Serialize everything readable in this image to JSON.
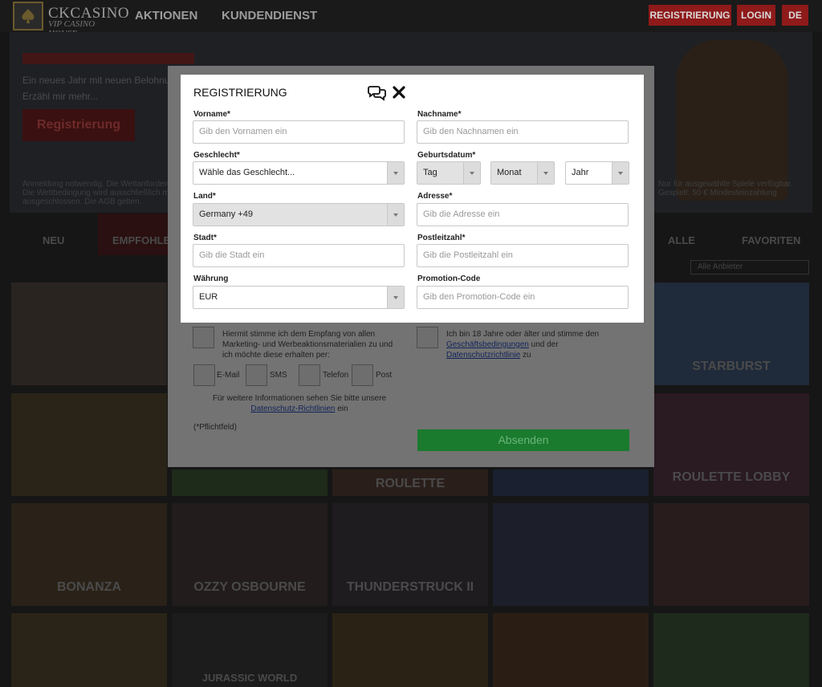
{
  "header": {
    "logo_name": "CKCASINO",
    "logo_sub": "VIP CASINO HOUSE",
    "nav": [
      "AKTIONEN",
      "KUNDENDIENST"
    ],
    "register_label": "REGISTRIERUNG",
    "login_label": "LOGIN",
    "lang_label": "DE"
  },
  "background": {
    "hero_sub_1": "Ein neues Jahr mit neuen Belohnungen",
    "hero_sub_2": "Erzähl mir mehr...",
    "hero_button": "Registrierung",
    "fine_left_1": "Anmeldung notwendig. Die Wettanforderungen",
    "fine_left_2": "Die Wettbedingung wird ausschließlich mit",
    "fine_left_3": "ausgeschlossen. Die AGB gelten.",
    "fine_right_1": "Nur für ausgewählte Spiele verfügbar.",
    "fine_right_2": "Gespielt: 50 € Mindesteinzahlung",
    "tabs": [
      "NEU",
      "EMPFOHLEN",
      "ALLE",
      "FAVORITEN"
    ],
    "provider_select": "Alle Anbieter",
    "tiles": [
      "",
      "STARBURST",
      "",
      "",
      "ROULETTE",
      "",
      "ROULETTE LOBBY",
      "BONANZA",
      "OZZY OSBOURNE",
      "THUNDERSTRUCK II",
      "",
      "",
      "",
      "JURASSIC WORLD",
      "",
      "",
      ""
    ]
  },
  "modal": {
    "title": "REGISTRIERUNG",
    "fields": {
      "first_name": {
        "label": "Vorname*",
        "placeholder": "Gib den Vornamen ein"
      },
      "last_name": {
        "label": "Nachname*",
        "placeholder": "Gib den Nachnamen ein"
      },
      "gender": {
        "label": "Geschlecht*",
        "value": "Wähle das Geschlecht..."
      },
      "birth": {
        "label": "Geburtsdatum*",
        "day": "Tag",
        "month": "Monat",
        "year": "Jahr"
      },
      "country": {
        "label": "Land*",
        "value": "Germany +49"
      },
      "address": {
        "label": "Adresse*",
        "placeholder": "Gib die Adresse ein"
      },
      "city": {
        "label": "Stadt*",
        "placeholder": "Gib die Stadt ein"
      },
      "zip": {
        "label": "Postleitzahl*",
        "placeholder": "Gib die Postleitzahl ein"
      },
      "currency": {
        "label": "Währung",
        "value": "EUR"
      },
      "promo": {
        "label": "Promotion-Code",
        "placeholder": "Gib den Promotion-Code ein"
      }
    },
    "marketing_consent": {
      "line1": "Hiermit stimme ich dem Empfang von allen",
      "line2": "Marketing- und Werbeaktionsmaterialien zu und",
      "line3": "ich möchte diese erhalten per:"
    },
    "age_consent": {
      "line1": "Ich bin 18 Jahre oder älter und stimme den",
      "link1": "Geschäftsbedingungen",
      "mid": " und der",
      "link2": "Datenschutzrichtlinie",
      "tail": " zu"
    },
    "channels": [
      "E-Mail",
      "SMS",
      "Telefon",
      "Post"
    ],
    "privacy_note": {
      "line1": "Für weitere Informationen sehen Sie bitte unsere",
      "link": "Datenschutz-Richtlinien",
      "tail": " ein"
    },
    "required_note": "(*Pflichtfeld)",
    "submit_label": "Absenden"
  }
}
